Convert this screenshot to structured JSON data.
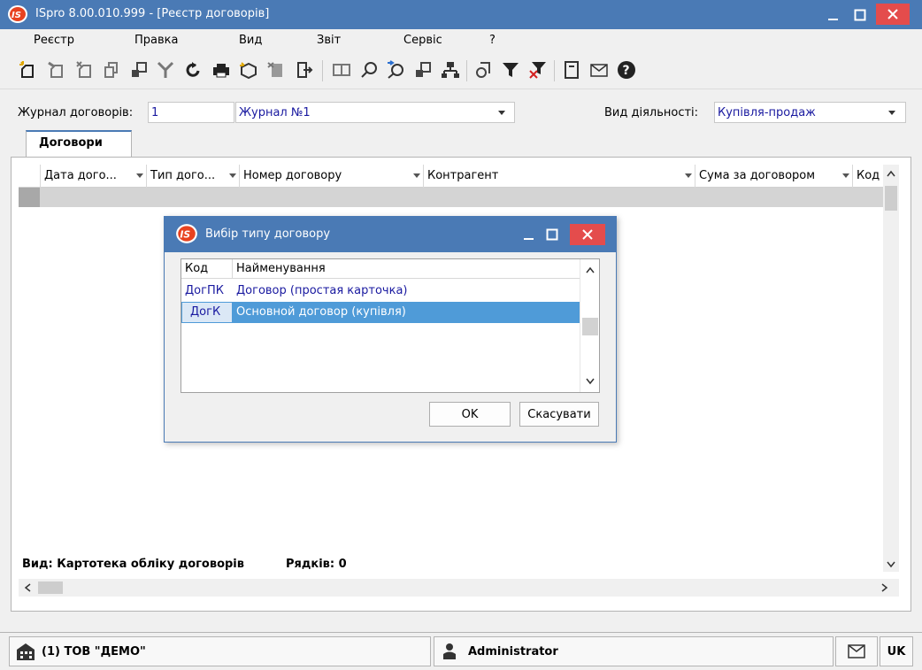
{
  "window": {
    "title": "ISpro 8.00.010.999 - [Реєстр договорів]"
  },
  "menu": [
    "Реєстр",
    "Правка",
    "Вид",
    "Звіт",
    "Сервіс",
    "?"
  ],
  "toolbar": {
    "icons": [
      "new-doc-icon",
      "copy-doc-icon",
      "new-from-icon",
      "duplicate-icon",
      "transfer-icon",
      "merge-icon",
      "refresh-icon",
      "print-icon",
      "package-icon",
      "delete-icon",
      "exit-icon",
      "book-icon",
      "find-icon",
      "find-next-icon",
      "move-icon",
      "hierarchy-icon",
      "history-icon",
      "filter-icon",
      "clear-filter-icon",
      "document-icon",
      "mail-icon",
      "help-icon"
    ]
  },
  "filters": {
    "journal_label": "Журнал договорів:",
    "journal_code": "1",
    "journal_name": "Журнал №1",
    "activity_label": "Вид діяльності:",
    "activity_value": "Купівля-продаж"
  },
  "tabs": [
    {
      "label": "Договори",
      "active": true
    }
  ],
  "grid": {
    "columns": [
      "Дата дого...",
      "Тип дого...",
      "Номер договору",
      "Контрагент",
      "Сума за договором",
      "Код"
    ],
    "status_view": "Вид: Картотека обліку договорів",
    "status_rows": "Рядків: 0"
  },
  "statusbar": {
    "company": "(1) ТОВ \"ДЕМО\"",
    "user": "Administrator",
    "lang": "UK"
  },
  "dialog": {
    "title": "Вибір типу договору",
    "columns": [
      "Код",
      "Найменування"
    ],
    "rows": [
      {
        "code": "ДогПК",
        "name": "Договор (простая карточка)",
        "selected": false
      },
      {
        "code": "ДогК",
        "name": "Основной договор (купівля)",
        "selected": true
      }
    ],
    "ok_label": "OK",
    "cancel_label": "Скасувати"
  },
  "colors": {
    "titlebar": "#4a7ab5",
    "close": "#e44c4c",
    "selection": "#4f9bd8",
    "link_text": "#1a1aa0"
  }
}
